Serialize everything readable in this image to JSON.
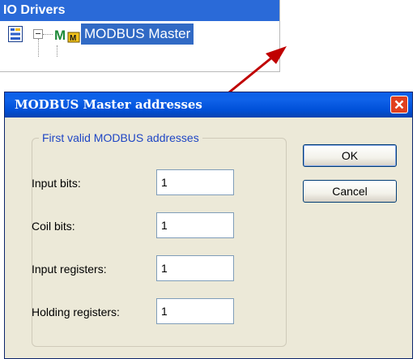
{
  "tree": {
    "header": "IO Drivers",
    "root_icon": "tree-root-icon",
    "node_icon": "modbus-master-icon",
    "node_label": "MODBUS Master"
  },
  "dialog": {
    "title": "MODBUS Master addresses",
    "group_title": "First valid MODBUS addresses",
    "fields": [
      {
        "label": "Input bits:",
        "value": "1"
      },
      {
        "label": "Coil bits:",
        "value": "1"
      },
      {
        "label": "Input registers:",
        "value": "1"
      },
      {
        "label": "Holding registers:",
        "value": "1"
      }
    ],
    "ok_label": "OK",
    "cancel_label": "Cancel"
  },
  "colors": {
    "titlebar_blue": "#0050d8",
    "close_red": "#e1401f",
    "arrow_red": "#c00000",
    "selection_blue": "#316ac5",
    "dialog_face": "#ece9d8"
  }
}
